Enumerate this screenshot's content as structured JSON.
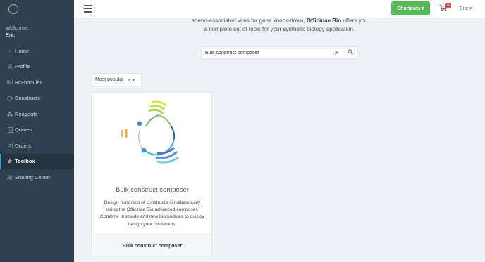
{
  "sidebar": {
    "welcome": "Welcome,",
    "user": "Eric",
    "items": [
      {
        "label": "Home",
        "icon": "home-icon"
      },
      {
        "label": "Profile",
        "icon": "user-icon"
      },
      {
        "label": "Biomodules",
        "icon": "biomodule-icon"
      },
      {
        "label": "Constructs",
        "icon": "construct-icon"
      },
      {
        "label": "Reagents",
        "icon": "reagent-icon"
      },
      {
        "label": "Quotes",
        "icon": "quote-icon"
      },
      {
        "label": "Orders",
        "icon": "orders-icon"
      },
      {
        "label": "Toolbox",
        "icon": "star-icon",
        "active": true
      },
      {
        "label": "Sharing Center",
        "icon": "users-icon"
      }
    ]
  },
  "topbar": {
    "shortcuts_label": "Shortcuts ▾",
    "cart_count": "3",
    "user_label": "Eric ▾"
  },
  "intro": {
    "line1": "adeno-associated virus for gene knock-down,",
    "brand": "Officinae Bio",
    "line1_end": "offers you",
    "line2": "a complete set of tools for your synthetic biology application."
  },
  "search": {
    "value": "Bulk construct composer",
    "clear_icon": "close-icon",
    "search_icon": "search-icon"
  },
  "sort": {
    "label": "Most popular"
  },
  "card": {
    "title": "Bulk construct composer",
    "description": "Design hundreds of constructs simultaneously using the Officinae Bio advanced composer. Combine premade and new biomodules to quickly design your constructs.",
    "footer": "Bulk construct composer"
  },
  "colors": {
    "sidebar": "#2f4050",
    "accent_green": "#5cb85c",
    "badge_red": "#d9534f"
  }
}
